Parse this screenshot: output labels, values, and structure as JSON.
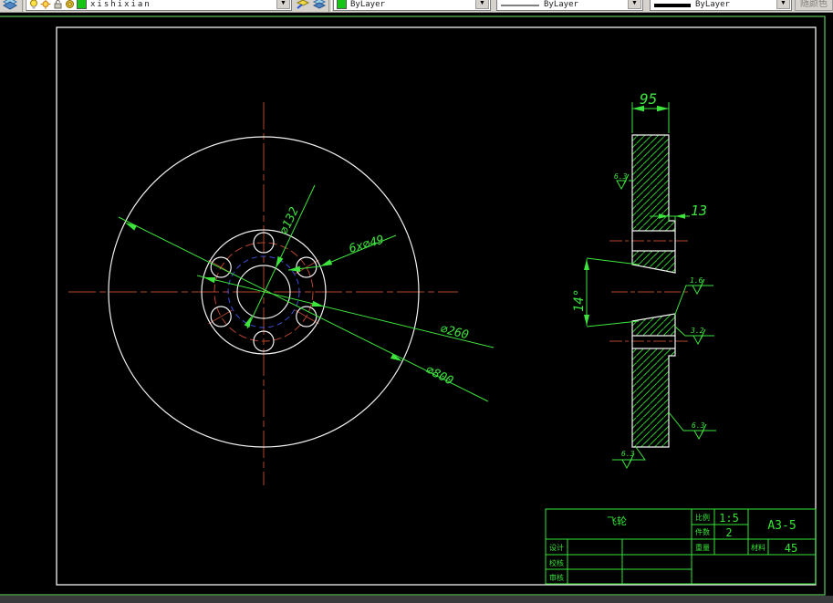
{
  "toolbar": {
    "layer_name": "xishixian",
    "color_value": "ByLayer",
    "linetype_value": "ByLayer",
    "lineweight_value": "ByLayer",
    "plot_style": "随颜色",
    "dropdown_glyph": "▼"
  },
  "drawing": {
    "front_view": {
      "dim_bore": "∅132",
      "dim_bolt_holes": "6x∅49",
      "dim_flange": "∅260",
      "dim_outer": "∅800"
    },
    "section_view": {
      "dim_width": "95",
      "dim_step": "13",
      "dim_taper_angle": "14°",
      "surface_finish": [
        "6.3",
        "1.6",
        "3.2",
        "6.3",
        "6.3"
      ]
    },
    "title_block": {
      "part_name": "飞轮",
      "scale_label": "比例",
      "scale_value": "1:5",
      "quantity_label": "件数",
      "quantity_value": "2",
      "drawing_no": "A3-5",
      "design_label": "设计",
      "weight_label": "重量",
      "material_label": "材料",
      "material_value": "45",
      "check_label": "校核",
      "review_label": "审核"
    }
  },
  "colors": {
    "line_white": "#f2f2f2",
    "center_red": "#b5462f",
    "aux_blue": "#4050d8",
    "dim_green": "#3ee43e",
    "hatch_green": "#2fc42f",
    "paper_border_green": "#4da04d"
  }
}
